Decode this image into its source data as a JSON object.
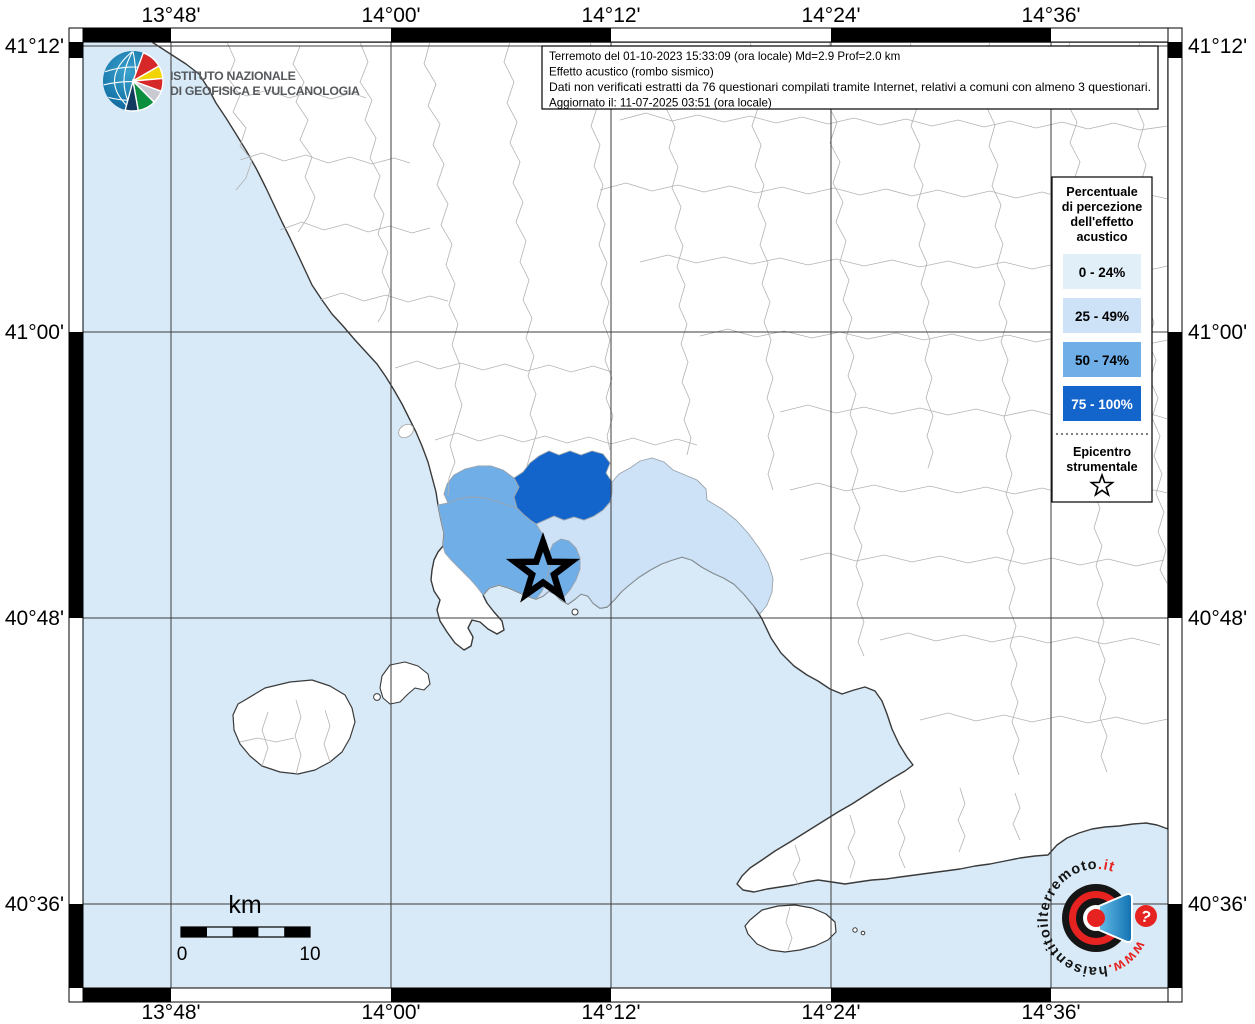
{
  "map": {
    "sea_color": "#d8eaf7",
    "land_color": "#ffffff"
  },
  "axes": {
    "lon": [
      "13°48'",
      "14°00'",
      "14°12'",
      "14°24'",
      "14°36'"
    ],
    "lat": [
      "41°12'",
      "41°00'",
      "40°48'",
      "40°36'"
    ]
  },
  "title_box": {
    "line1": "Terremoto del 01-10-2023 15:33:09 (ora locale) Md=2.9 Prof=2.0 km",
    "line2": "Effetto acustico (rombo sismico)",
    "line3": "Dati non verificati estratti da 76 questionari compilati tramite Internet, relativi a comuni con almeno 3 questionari.",
    "line4": "Aggiornato il: 11-07-2025 03:51 (ora locale)"
  },
  "legend": {
    "title_lines": [
      "Percentuale",
      "di percezione",
      "dell'effetto",
      "acustico"
    ],
    "classes": [
      {
        "label": "0 - 24%",
        "color": "#e1eff9"
      },
      {
        "label": "25 - 49%",
        "color": "#cde2f6"
      },
      {
        "label": "50 - 74%",
        "color": "#70aee8"
      },
      {
        "label": "75 - 100%",
        "color": "#1465cb"
      }
    ],
    "epicenter_lines": [
      "Epicentro",
      "strumentale"
    ]
  },
  "scalebar": {
    "unit": "km",
    "start": "0",
    "end": "10"
  },
  "ingv_logo": {
    "line1": "ISTITUTO NAZIONALE",
    "line2": "DI GEOFISICA E VULCANOLOGIA"
  },
  "site_logo": {
    "prefix": "www.",
    "name": "haisentitoilterremoto",
    "tld": ".it",
    "question": "?",
    "accent_red": "#e62320",
    "accent_blue": "#2e93cd"
  }
}
